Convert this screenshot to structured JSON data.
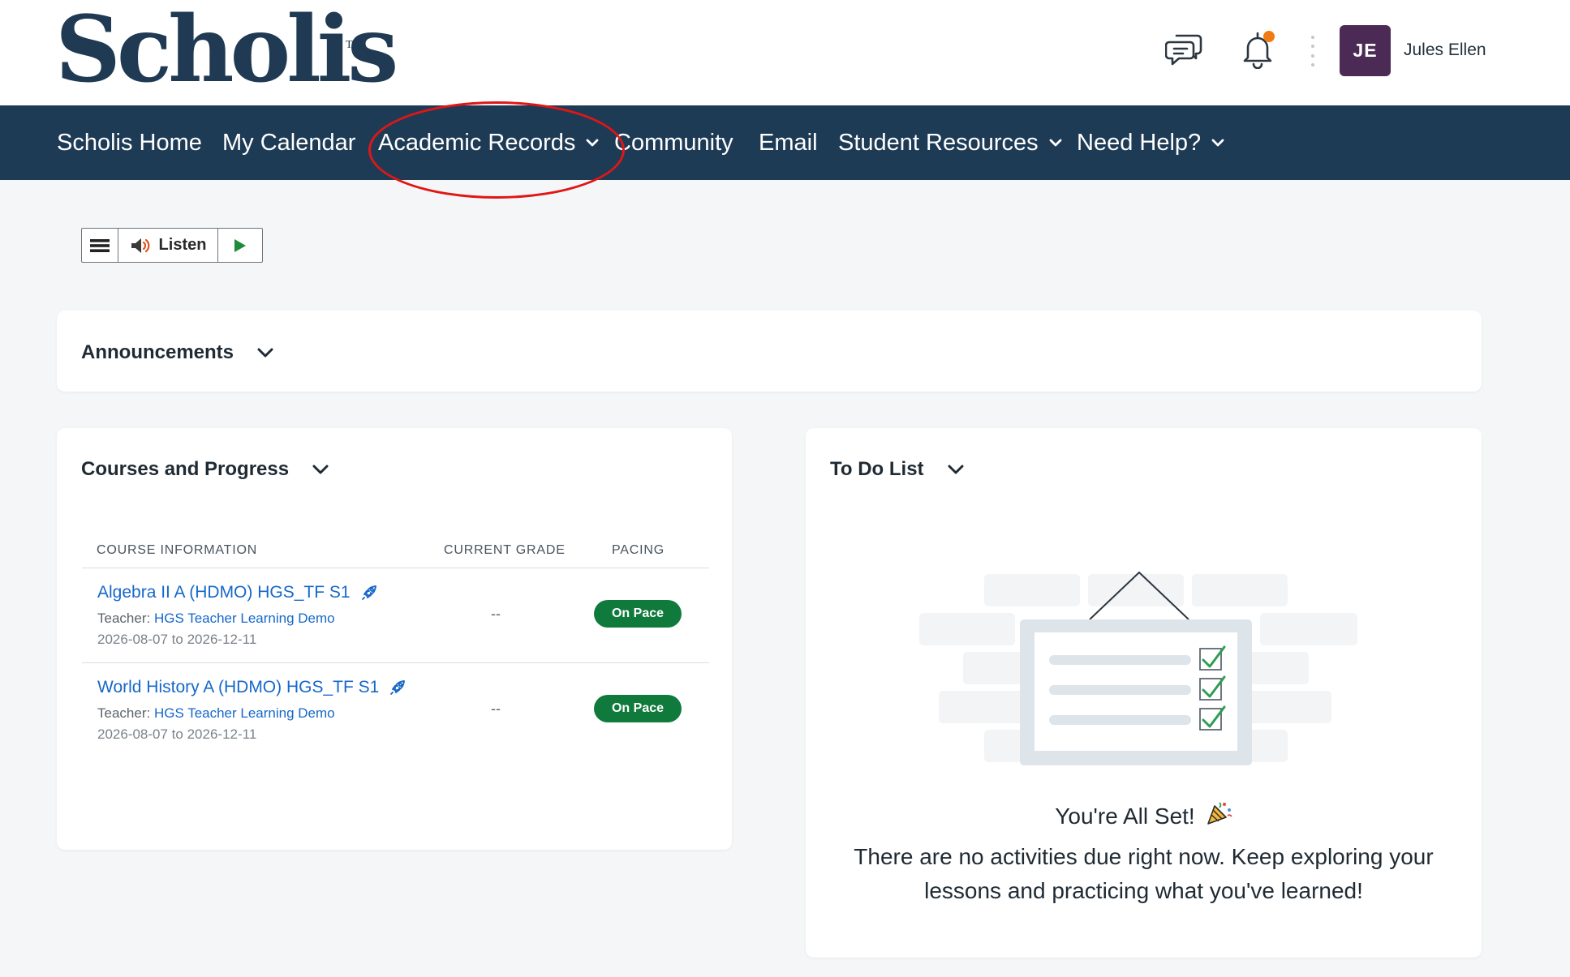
{
  "brand": {
    "name": "Scholis",
    "tm": "TM"
  },
  "header": {
    "user": {
      "initials": "JE",
      "name": "Jules Ellen"
    },
    "colors": {
      "avatar": "#4b2b55",
      "notification_dot": "#f07b12",
      "nav_bg": "#1e3b56"
    }
  },
  "nav": {
    "items": [
      {
        "label": "Scholis Home"
      },
      {
        "label": "My Calendar"
      },
      {
        "label": "Academic Records"
      },
      {
        "label": "Community"
      },
      {
        "label": "Email"
      },
      {
        "label": "Student Resources"
      },
      {
        "label": "Need Help?"
      }
    ]
  },
  "listen_toolbar": {
    "label": "Listen"
  },
  "announcements": {
    "title": "Announcements"
  },
  "courses": {
    "title": "Courses and Progress",
    "columns": [
      "COURSE INFORMATION",
      "CURRENT GRADE",
      "PACING"
    ],
    "rows": [
      {
        "name": "Algebra II A (HDMO) HGS_TF S1",
        "teacher_label": "Teacher:",
        "teacher": "HGS Teacher Learning Demo",
        "dates": "2026-08-07 to 2026-12-11",
        "grade": "--",
        "pacing": "On Pace"
      },
      {
        "name": "World History A (HDMO) HGS_TF S1",
        "teacher_label": "Teacher:",
        "teacher": "HGS Teacher Learning Demo",
        "dates": "2026-08-07 to 2026-12-11",
        "grade": "--",
        "pacing": "On Pace"
      }
    ]
  },
  "todo": {
    "title": "To Do List",
    "heading": "You're All Set!",
    "message": "There are no activities due right now. Keep exploring your lessons and practicing what you've learned!"
  }
}
